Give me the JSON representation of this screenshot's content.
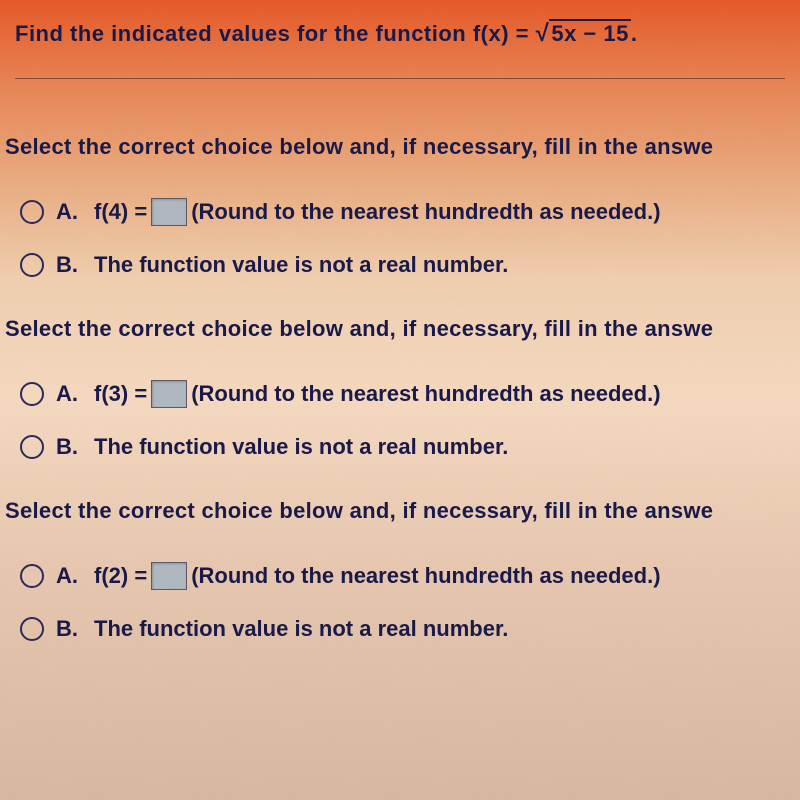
{
  "header": {
    "prefix": "Find the indicated values for the function f(x) = ",
    "radicand": "5x − 15",
    "suffix": "."
  },
  "prompt": "Select the correct choice below and, if necessary, fill in the answe",
  "questions": [
    {
      "choice_a_letter": "A.",
      "choice_a_fn": "f(4) =",
      "choice_a_hint": "(Round to the nearest hundredth as needed.)",
      "choice_b_letter": "B.",
      "choice_b_text": "The function value is not a real number."
    },
    {
      "choice_a_letter": "A.",
      "choice_a_fn": "f(3) =",
      "choice_a_hint": "(Round to the nearest hundredth as needed.)",
      "choice_b_letter": "B.",
      "choice_b_text": "The function value is not a real number."
    },
    {
      "choice_a_letter": "A.",
      "choice_a_fn": "f(2) =",
      "choice_a_hint": "(Round to the nearest hundredth as needed.)",
      "choice_b_letter": "B.",
      "choice_b_text": "The function value is not a real number."
    }
  ]
}
